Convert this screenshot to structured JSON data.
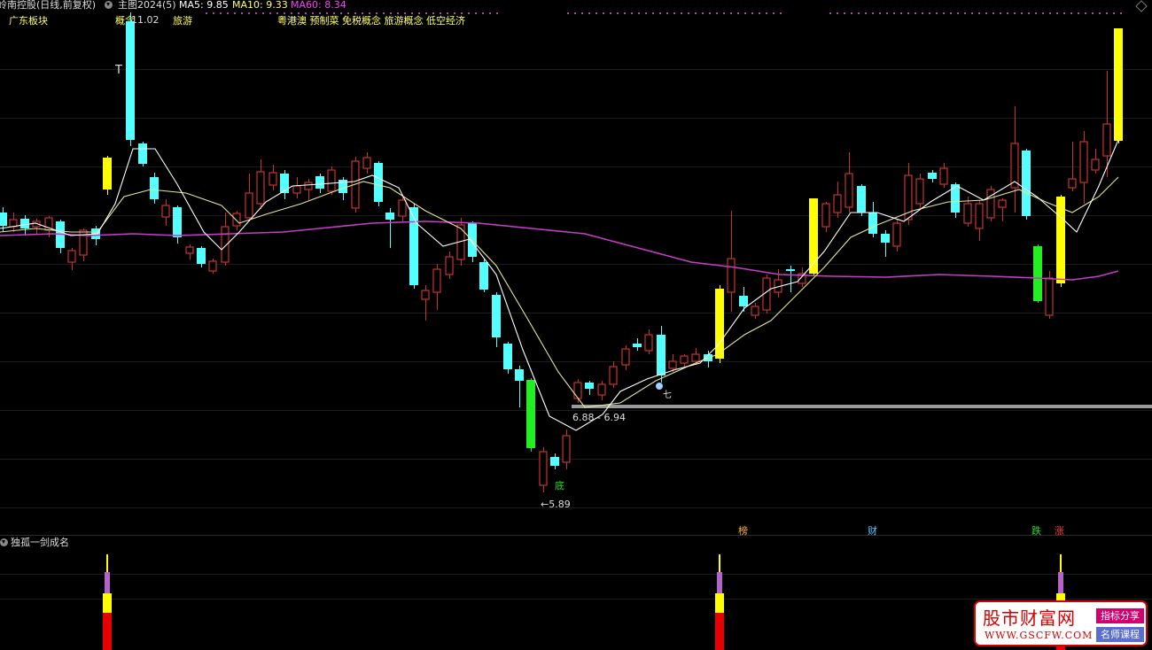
{
  "header": {
    "stock_title": "岭南控股(日线,前复权)",
    "indicator_name": "主图2024(5)",
    "ma5_label": "MA5: 9.85",
    "ma10_label": "MA10: 9.33",
    "ma60_label": "MA60: 8.34",
    "colors": {
      "ma5": "#ffffff",
      "ma10": "#ffff66",
      "ma60": "#ff3cff",
      "title": "#dddddd"
    }
  },
  "tags": {
    "sector": "广东板块",
    "concept_prefix": "概念",
    "concept_first": "旅游",
    "concepts": "粤港澳 预制菜 免税概念 旅游概念 低空经济"
  },
  "annotations": {
    "high_value": "11.02",
    "marker_t": "T",
    "low_value": "←5.89",
    "bottom_char": "底",
    "range_label": "6.88 - 6.94",
    "signal_qi": "七",
    "sig_bang": "榜",
    "sig_cai": "财",
    "sig_die": "跌",
    "sig_zhang": "涨"
  },
  "sub_panel": {
    "title": "独孤一剑成名"
  },
  "watermark": {
    "main": "股市财富网",
    "url": "WWW.GSCFW.COM",
    "badge1": "指标分享",
    "badge2": "名师课程"
  },
  "chart_data": {
    "type": "candlestick",
    "series": [
      {
        "name": "MA5"
      },
      {
        "name": "MA10"
      },
      {
        "name": "MA60"
      }
    ],
    "price_high": 11.02,
    "price_low": 5.89,
    "support_zone": [
      6.88,
      6.94
    ]
  }
}
